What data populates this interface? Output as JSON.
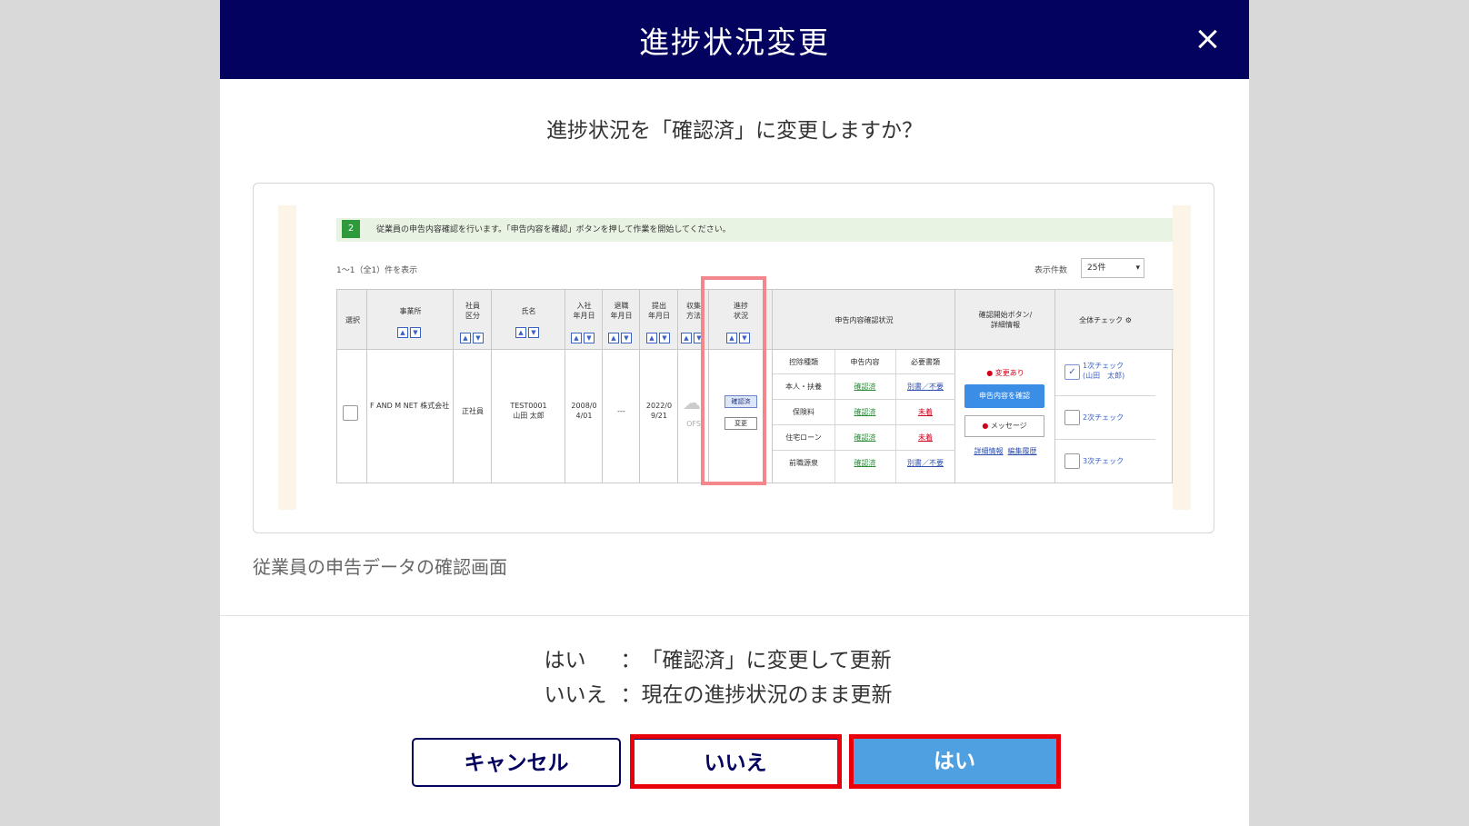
{
  "modal": {
    "title": "進捗状況変更",
    "question": "進捗状況を「確認済」に変更しますか？",
    "caption": "従業員の申告データの確認画面",
    "explanations": [
      {
        "key": "はい",
        "sep": "：",
        "text": "「確認済」に変更して更新"
      },
      {
        "key": "いいえ",
        "sep": "：",
        "text": "現在の進捗状況のまま更新"
      }
    ],
    "buttons": {
      "cancel": "キャンセル",
      "no": "いいえ",
      "yes": "はい"
    }
  },
  "preview": {
    "step_number": "2",
    "notice": "従業員の申告内容確認を行います。「申告内容を確認」ボタンを押して作業を開始してください。",
    "count_text": "1〜1（全1）件を表示",
    "per_page_label": "表示件数",
    "per_page_value": "25件",
    "headers": {
      "select": "選択",
      "office": "事業所",
      "employee_type": "社員\n区分",
      "name": "氏名",
      "joined": "入社\n年月日",
      "left": "退職\n年月日",
      "submitted": "提出\n年月日",
      "method": "収集\n方法",
      "progress": "進捗\n状況",
      "declaration_status": "申告内容確認状況",
      "start_button": "確認開始ボタン/\n詳細情報",
      "overall_check": "全体チェック"
    },
    "row": {
      "office": "F AND M NET 株式会社",
      "employee_type": "正社員",
      "name": "TEST0001\n山田 太郎",
      "joined": "2008/0\n4/01",
      "left": "---",
      "submitted": "2022/0\n9/21",
      "method": "OFS",
      "progress_badge": "確認済",
      "change_button": "変更",
      "sub_headers": [
        "控除種類",
        "申告内容",
        "必要書類"
      ],
      "sub_rows": [
        [
          "本人・扶養",
          "確認済",
          "別書／不要"
        ],
        [
          "保険料",
          "確認済",
          "未着"
        ],
        [
          "住宅ローン",
          "確認済",
          "未着"
        ],
        [
          "前職源泉",
          "確認済",
          "別書／不要"
        ]
      ],
      "change_flag": "変更あり",
      "confirm_button": "申告内容を確認",
      "message_button": "メッセージ",
      "links": [
        "詳細情報",
        "編集履歴"
      ],
      "checks": [
        {
          "label": "1次チェック\n(山田　太郎)",
          "checked": true
        },
        {
          "label": "2次チェック",
          "checked": false
        },
        {
          "label": "3次チェック",
          "checked": false
        }
      ]
    }
  }
}
